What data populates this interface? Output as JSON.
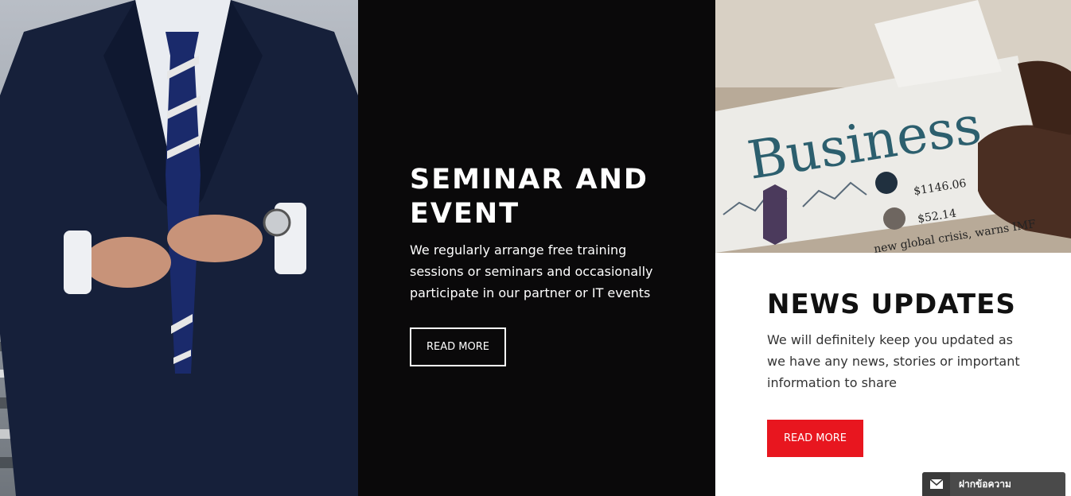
{
  "seminar": {
    "title": "SEMINAR AND EVENT",
    "description": "We regularly arrange free training sessions or seminars and occasionally participate in our partner or IT events",
    "button_label": "READ MORE"
  },
  "news": {
    "title": "NEWS UPDATES",
    "description": "We will definitely keep you updated as we have any news, stories or important information to share",
    "button_label": "READ MORE",
    "photo_headline": "Business",
    "photo_price_1": "$1146.06",
    "photo_price_2": "$52.14",
    "photo_subhead": "new global crisis, warns IMF"
  },
  "chat": {
    "label": "ฝากข้อความ",
    "icon": "envelope-icon"
  },
  "colors": {
    "accent": "#e8161f",
    "dark_panel": "#0a090a",
    "chat_bg": "#4a4a4a"
  }
}
